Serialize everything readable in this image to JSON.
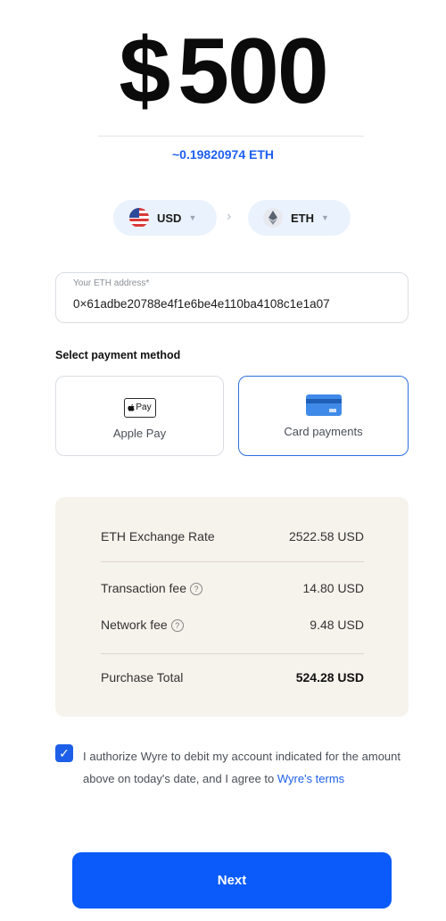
{
  "amount": {
    "symbol": "$",
    "value": "500"
  },
  "crypto_amount": "~0.19820974 ETH",
  "currency_from": {
    "code": "USD",
    "icon": "us-flag-icon"
  },
  "currency_to": {
    "code": "ETH",
    "icon": "ethereum-icon"
  },
  "address": {
    "label": "Your ETH address*",
    "value": "0×61adbe20788e4f1e6be4e110ba4108c1e1a07"
  },
  "payment": {
    "section_title": "Select payment method",
    "methods": [
      {
        "label": "Apple Pay",
        "icon": "apple-pay-icon",
        "icon_text": " Pay",
        "selected": false
      },
      {
        "label": "Card payments",
        "icon": "credit-card-icon",
        "selected": true
      }
    ]
  },
  "summary": {
    "rows": [
      {
        "label": "ETH Exchange Rate",
        "value": "2522.58 USD"
      },
      {
        "label": "Transaction fee",
        "value": "14.80 USD"
      },
      {
        "label": "Network fee",
        "value": "9.48 USD"
      },
      {
        "label": "Purchase Total",
        "value": "524.28 USD"
      }
    ]
  },
  "consent": {
    "checked": true,
    "text": "I authorize Wyre to debit my account indicated for the amount above on today's date, and I agree to ",
    "link_text": "Wyre's terms"
  },
  "next_label": "Next",
  "colors": {
    "accent": "#0a5bfa",
    "link": "#1d5fe8",
    "summary_bg": "#f6f2ec",
    "pill_bg": "#eaf2fd"
  }
}
